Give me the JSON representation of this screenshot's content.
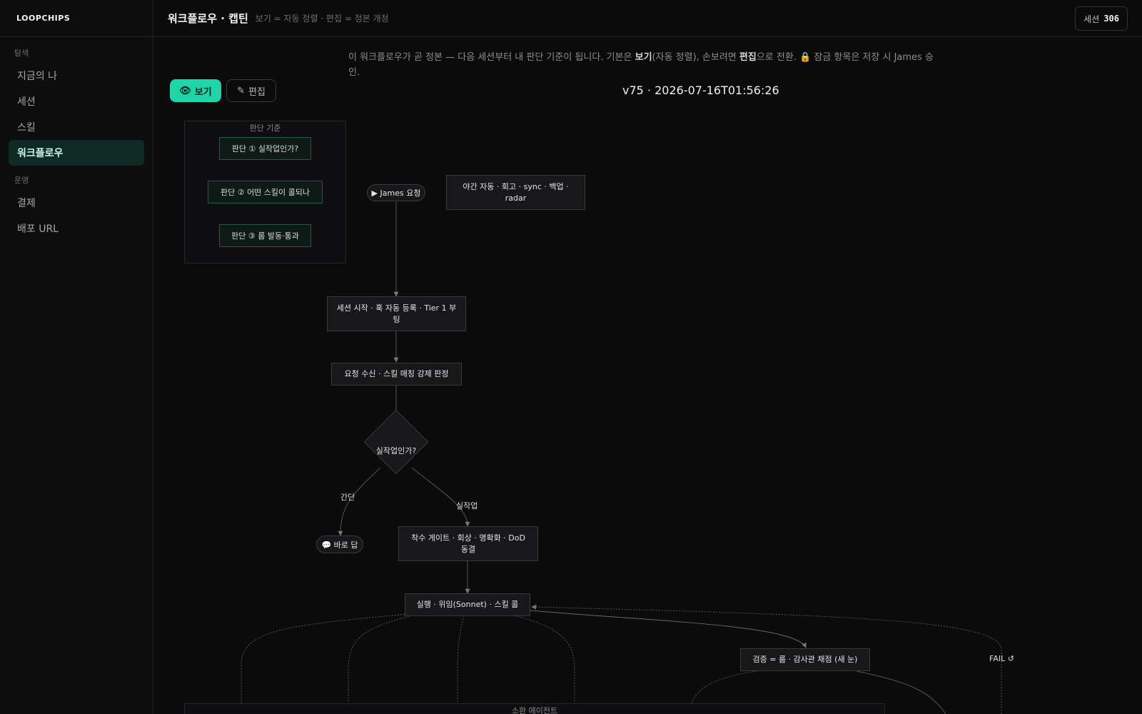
{
  "app": {
    "logo": "LOOPCHIPS"
  },
  "sidebar": {
    "sections": [
      {
        "label": "탐색",
        "items": [
          {
            "label": "지금의 나",
            "active": false
          },
          {
            "label": "세션",
            "active": false
          },
          {
            "label": "스킬",
            "active": false
          },
          {
            "label": "워크플로우",
            "active": true
          }
        ]
      },
      {
        "label": "운영",
        "items": [
          {
            "label": "결제",
            "active": false
          },
          {
            "label": "배포 URL",
            "active": false
          }
        ]
      }
    ]
  },
  "header": {
    "title": "워크플로우 · 캡틴",
    "subtitle": "보기 = 자동 정렬 · 편집 = 정본 개정",
    "session_label": "세션",
    "session_count": "306"
  },
  "main": {
    "description": {
      "part1": "이 워크플로우가 곧 정본 — 다음 세션부터 내 판단 기준이 됩니다. 기본은 ",
      "view_word": "보기",
      "part2": "(자동 정렬), 손보려면 ",
      "edit_word": "편집",
      "part3": "으로 전환. 🔒 잠금 항목은 저장 시 James 승인."
    },
    "modes": {
      "view_label": "보기",
      "view_icon": "👁",
      "edit_label": "편집",
      "edit_icon": "✎"
    },
    "version": "v75 · 2026-07-16T01:56:26"
  },
  "diagram": {
    "criteria_group": {
      "label": "판단 기준",
      "items": [
        "판단 ① 실작업인가?",
        "판단 ② 어떤 스킬이 콜되나",
        "판단 ③ 룹 발동·통과"
      ]
    },
    "start_pill": "▶ James 요청",
    "nightly": "야간 자동  ·  회고 · sync · 백업 · radar",
    "session_start": "세션 시작  ·  훅 자동 등록 · Tier 1 부팅",
    "request": "요청 수신 · 스킬 매칭 강제 판정",
    "decision": "실작업인가?",
    "edge_simple": "간단",
    "edge_real": "실작업",
    "quick_reply": "💬 바로 답",
    "gate": "착수 게이트  ·  회상 · 명확화 · DoD 동결",
    "execute": "실행 · 위임(Sonnet) · 스킬 콜",
    "verify": "검증 = 룹 · 감사관 채점 (새 눈)",
    "fail_label": "FAIL ↺",
    "agents_group_label": "소환 에이전트"
  }
}
